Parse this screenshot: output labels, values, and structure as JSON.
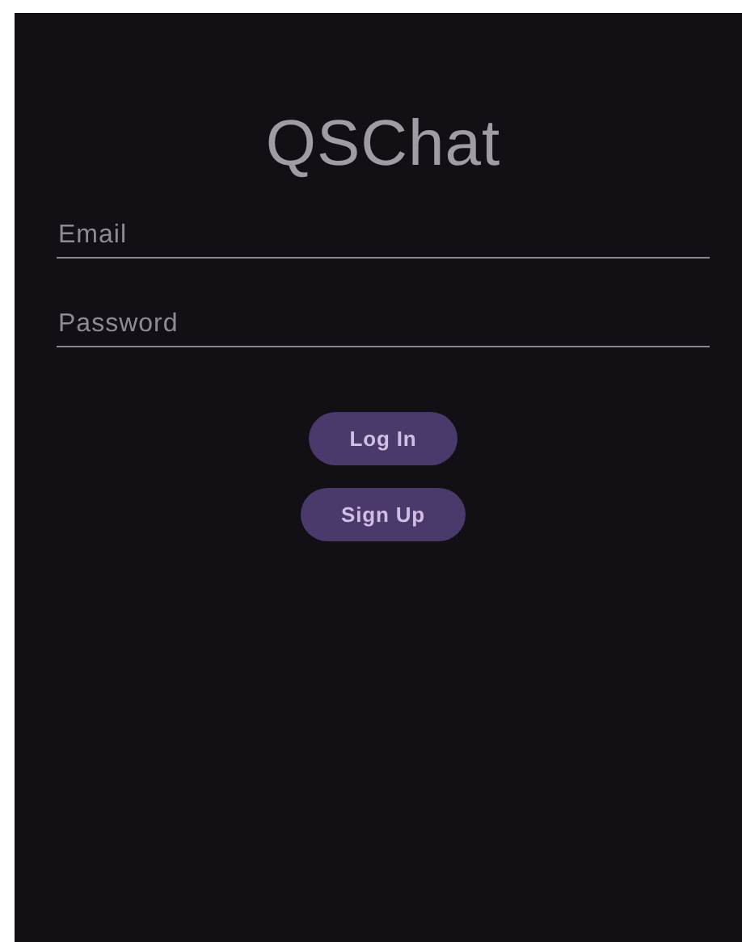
{
  "title": "QSChat",
  "fields": [
    {
      "placeholder": "Email"
    },
    {
      "placeholder": "Password"
    }
  ],
  "buttons": [
    "Log In",
    "Sign Up"
  ]
}
